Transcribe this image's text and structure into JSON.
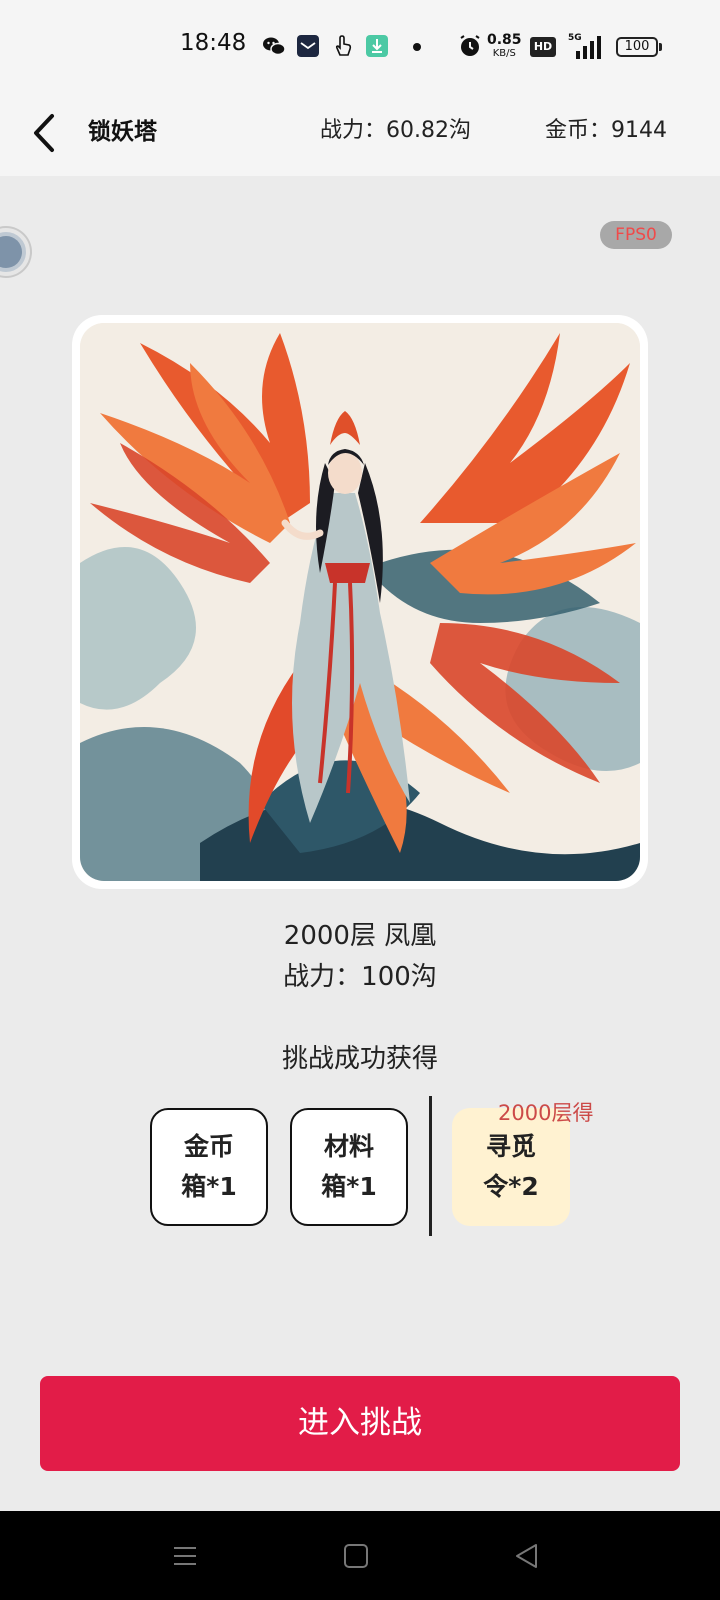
{
  "status_bar": {
    "time": "18:48",
    "net_speed_value": "0.85",
    "net_speed_unit": "KB/S",
    "hd_label": "HD",
    "signal_label": "5G",
    "battery_level": "100",
    "icons": [
      "wechat-icon",
      "mail-app-icon",
      "hand-gesture-icon",
      "download-icon",
      "notification-dot",
      "alarm-icon"
    ]
  },
  "header": {
    "title": "锁妖塔",
    "power_text": "战力：60.82沟",
    "coins_text": "金币：9144"
  },
  "fps_label": "FPS0",
  "boss": {
    "floor_name": "2000层 凤凰",
    "power_text": "战力：100沟"
  },
  "rewards": {
    "heading": "挑战成功获得",
    "items": [
      {
        "line1": "金币",
        "line2": "箱*1"
      },
      {
        "line1": "材料",
        "line2": "箱*1"
      }
    ],
    "special": {
      "tag": "2000层得",
      "line1": "寻觅",
      "line2": "令*2"
    }
  },
  "enter_button_label": "进入挑战",
  "colors": {
    "accent": "#e21c48",
    "special_bg": "#fff2d1",
    "special_tag": "#cc4a48",
    "fps_text": "#f04a4a"
  }
}
